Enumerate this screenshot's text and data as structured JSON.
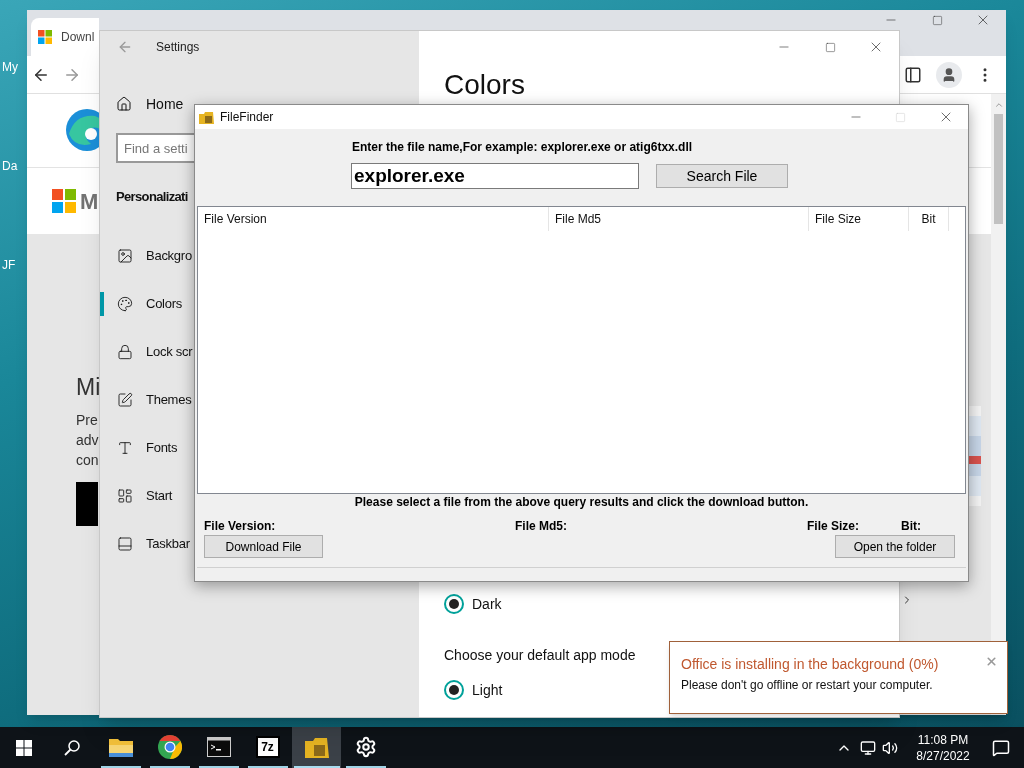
{
  "desktop": {
    "icon_labels": [
      "My",
      "Da",
      "JF"
    ]
  },
  "browser": {
    "tab_title": "Downl",
    "page": {
      "logo_text": "M",
      "heading": "Mi",
      "paragraph_lines": [
        "Pre",
        "adv",
        "con"
      ]
    }
  },
  "settings": {
    "title": "Settings",
    "home": "Home",
    "search_placeholder": "Find a setti",
    "section_title": "Personalizati",
    "nav": [
      {
        "kind": "background",
        "label": "Backgro",
        "selected": false
      },
      {
        "kind": "colors",
        "label": "Colors",
        "selected": true
      },
      {
        "kind": "lock",
        "label": "Lock scr",
        "selected": false
      },
      {
        "kind": "themes",
        "label": "Themes",
        "selected": false
      },
      {
        "kind": "fonts",
        "label": "Fonts",
        "selected": false
      },
      {
        "kind": "start",
        "label": "Start",
        "selected": false
      },
      {
        "kind": "taskbar",
        "label": "Taskbar",
        "selected": false
      }
    ],
    "page_title": "Colors",
    "options": [
      {
        "kind": "radio",
        "label": "Dark",
        "selected": true
      },
      {
        "kind": "text",
        "label": "Choose your default app mode"
      },
      {
        "kind": "radio",
        "label": "Light",
        "selected": true
      }
    ]
  },
  "filefinder": {
    "title": "FileFinder",
    "maximize_disabled": true,
    "prompt": "Enter the file name,For example: explorer.exe or atig6txx.dll",
    "query": "explorer.exe",
    "search_button": "Search File",
    "columns": [
      "File Version",
      "File Md5",
      "File Size",
      "Bit"
    ],
    "hint": "Please select a file from the above query results and click the download button.",
    "detail_labels": [
      "File Version:",
      "File Md5:",
      "File Size:",
      "Bit:"
    ],
    "download_button": "Download File",
    "open_folder_button": "Open the folder"
  },
  "toast": {
    "title": "Office is installing in the background (0%)",
    "message": "Please don't go offline or restart your computer."
  },
  "taskbar": {
    "apps": [
      {
        "kind": "explorer",
        "running": true,
        "active": false
      },
      {
        "kind": "chrome",
        "running": true,
        "active": false
      },
      {
        "kind": "terminal",
        "running": true,
        "active": false
      },
      {
        "kind": "archiver",
        "badge": "7z",
        "running": true,
        "active": false
      },
      {
        "kind": "filefinder",
        "running": true,
        "active": true
      },
      {
        "kind": "settings",
        "running": true,
        "active": false
      }
    ],
    "time": "11:08 PM",
    "date": "8/27/2022"
  }
}
